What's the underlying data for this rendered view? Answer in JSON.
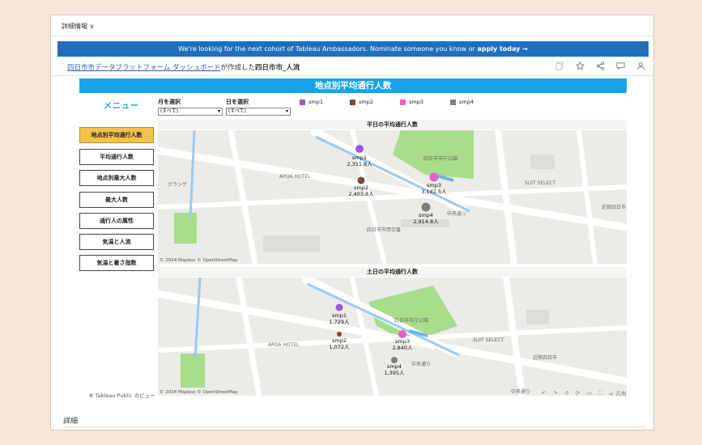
{
  "topbar": {
    "label": "詳細情報 ∨"
  },
  "banner": {
    "text": "We're looking for the next cohort of Tableau Ambassadors. Nominate someone you know or ",
    "link": "apply today →"
  },
  "titlebar": {
    "author": "四日市市データプラットフォーム ダッシュボード",
    "mid": "が作成した",
    "name": "四日市市_人流"
  },
  "dashboard": {
    "title": "地点別平均通行人数",
    "menu_title": "メニュー",
    "menu": [
      "地点別平均通行人数",
      "平均通行人数",
      "地点別最大人数",
      "最大人数",
      "通行人の属性",
      "気温と人流",
      "気温と暑さ指数"
    ],
    "filters": [
      {
        "label": "月を選択",
        "value": "(すべて)"
      },
      {
        "label": "日を選択",
        "value": "(すべて)"
      }
    ],
    "legend": [
      {
        "name": "smp1",
        "color": "#9b59d0"
      },
      {
        "name": "smp2",
        "color": "#7a4a3a"
      },
      {
        "name": "smp3",
        "color": "#e360c4"
      },
      {
        "name": "smp4",
        "color": "#7f7f7f"
      }
    ],
    "weekday": {
      "title": "平日の平均通行人数",
      "credit": "© 2024 Mapbox © OpenStreetMap",
      "points": [
        {
          "name": "smp1",
          "value": "2,351.8人"
        },
        {
          "name": "smp2",
          "value": "2,403.8人"
        },
        {
          "name": "smp3",
          "value": "3,141.5人"
        },
        {
          "name": "smp4",
          "value": "2,914.8人"
        }
      ],
      "places": [
        "四日市市庁公園",
        "APOA HOTEL",
        "SUIT SELECT",
        "中央通り",
        "近鉄四日市",
        "グランゲ",
        "四日市市西交番"
      ]
    },
    "weekend": {
      "title": "土日の平均通行人数",
      "credit": "© 2024 Mapbox © OpenStreetMap",
      "points": [
        {
          "name": "smp1",
          "value": "1,729人"
        },
        {
          "name": "smp2",
          "value": "1,072人"
        },
        {
          "name": "smp3",
          "value": "2,840人"
        },
        {
          "name": "smp4",
          "value": "1,395人"
        }
      ],
      "places": [
        "四日市市庁公園",
        "APOA HOTEL",
        "SUIT SELECT",
        "中央通り",
        "近鉄四日市",
        "中央通り"
      ]
    }
  },
  "footer": {
    "text": "Tableau Public のビュー",
    "share": "共有"
  },
  "detail": "詳細"
}
